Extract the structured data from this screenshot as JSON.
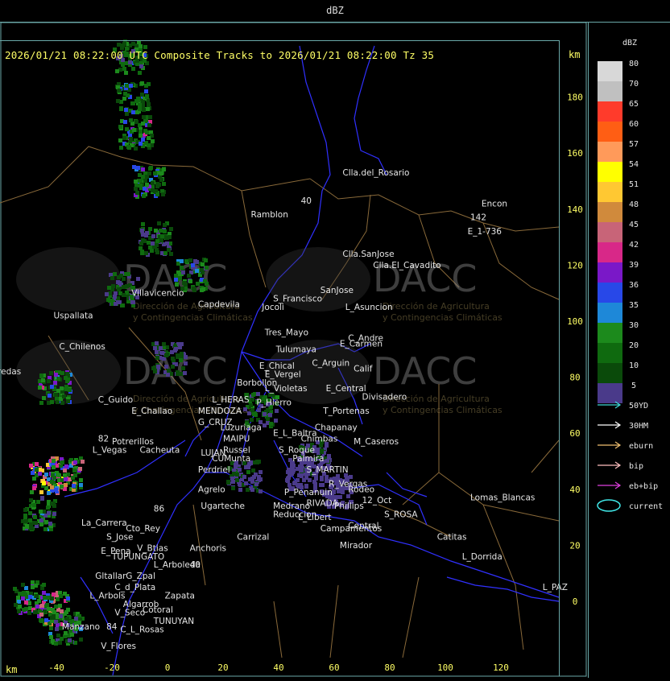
{
  "title_bar": "dBZ",
  "info_line": "2026/01/21 08:22:00 UTC Composite Tracks to 2026/01/21 08:22:00 Tz 35",
  "axis_unit_top": "km",
  "axis_unit_bottom": "km",
  "colors": {
    "frame": "#6aa8a8",
    "tick_text": "#ffff66",
    "province_border": "#8a6a3a",
    "road": "#3030ff",
    "label": "#e6e6e6"
  },
  "chart_data": {
    "type": "heatmap",
    "title": "2026/01/21 08:22:00 UTC Composite Tracks to 2026/01/21 08:22:00 Tz 35",
    "xlabel": "km",
    "ylabel": "km",
    "xlim": [
      -62,
      141
    ],
    "ylim": [
      -22,
      202
    ],
    "x_ticks": [
      -40,
      -20,
      0,
      20,
      40,
      60,
      80,
      100,
      120
    ],
    "y_ticks": [
      0,
      20,
      40,
      60,
      80,
      100,
      120,
      140,
      160,
      180
    ],
    "colorbar": {
      "label": "dBZ",
      "levels": [
        {
          "value": "80",
          "color": "#d8d8d8"
        },
        {
          "value": "70",
          "color": "#c0c0c0"
        },
        {
          "value": "65",
          "color": "#ff3b2b"
        },
        {
          "value": "60",
          "color": "#ff5e14"
        },
        {
          "value": "57",
          "color": "#ff9a5a"
        },
        {
          "value": "54",
          "color": "#ffff00"
        },
        {
          "value": "51",
          "color": "#ffc832"
        },
        {
          "value": "48",
          "color": "#d08a3c"
        },
        {
          "value": "45",
          "color": "#c86478"
        },
        {
          "value": "42",
          "color": "#d82888"
        },
        {
          "value": "39",
          "color": "#7a18c8"
        },
        {
          "value": "36",
          "color": "#2848e8"
        },
        {
          "value": "35",
          "color": "#1e88d8"
        },
        {
          "value": "30",
          "color": "#1c8a1c"
        },
        {
          "value": "20",
          "color": "#0f6a0f"
        },
        {
          "value": "10",
          "color": "#0a4a0a"
        },
        {
          "value": "5",
          "color": "#4a3a8a"
        }
      ]
    },
    "legend": [
      {
        "label": "50YD",
        "color": "#40d8d8"
      },
      {
        "label": "30HM",
        "color": "#ffffff"
      },
      {
        "label": "eburn",
        "color": "#f0c070"
      },
      {
        "label": "bip",
        "color": "#ffc0c0"
      },
      {
        "label": "eb+bip",
        "color": "#e040e0"
      },
      {
        "label": "current",
        "color": "#40e8e8"
      }
    ],
    "locations": [
      {
        "name": "Clla.del_Rosario",
        "x": 63,
        "y": 152
      },
      {
        "name": "Encon",
        "x": 113,
        "y": 141
      },
      {
        "name": "E_1-736",
        "x": 108,
        "y": 131
      },
      {
        "name": "Ramblon",
        "x": 30,
        "y": 137
      },
      {
        "name": "Clla.SanJose",
        "x": 63,
        "y": 123
      },
      {
        "name": "Clla.El_Cavadito",
        "x": 74,
        "y": 119
      },
      {
        "name": "Villavicencio",
        "x": -13,
        "y": 109
      },
      {
        "name": "Capdevila",
        "x": 11,
        "y": 105
      },
      {
        "name": "S_Francisco",
        "x": 38,
        "y": 107
      },
      {
        "name": "SanJose",
        "x": 55,
        "y": 110
      },
      {
        "name": "Jocoli",
        "x": 34,
        "y": 104
      },
      {
        "name": "L_Asuncion",
        "x": 64,
        "y": 104
      },
      {
        "name": "Uspallata",
        "x": -41,
        "y": 101
      },
      {
        "name": "Tres_Mayo",
        "x": 35,
        "y": 95
      },
      {
        "name": "C_Andre",
        "x": 65,
        "y": 93
      },
      {
        "name": "C_Chilenos",
        "x": -39,
        "y": 90
      },
      {
        "name": "Tulumaya",
        "x": 39,
        "y": 89
      },
      {
        "name": "E_Carmen",
        "x": 62,
        "y": 91
      },
      {
        "name": "C_Arguin",
        "x": 52,
        "y": 84
      },
      {
        "name": "Calif",
        "x": 67,
        "y": 82
      },
      {
        "name": "E_Chical",
        "x": 33,
        "y": 83
      },
      {
        "name": "E_Vergel",
        "x": 35,
        "y": 80
      },
      {
        "name": "Borbollon",
        "x": 25,
        "y": 77
      },
      {
        "name": "L_Violetas",
        "x": 35,
        "y": 75
      },
      {
        "name": "E_Central",
        "x": 57,
        "y": 75
      },
      {
        "name": "Divisadero",
        "x": 70,
        "y": 72
      },
      {
        "name": "L_HERAS",
        "x": 16,
        "y": 71
      },
      {
        "name": "C_Guido",
        "x": -25,
        "y": 71
      },
      {
        "name": "P_Hierro",
        "x": 32,
        "y": 70
      },
      {
        "name": "E_Challao",
        "x": -13,
        "y": 67
      },
      {
        "name": "MENDOZA",
        "x": 11,
        "y": 67
      },
      {
        "name": "T_Portenas",
        "x": 56,
        "y": 67
      },
      {
        "name": "G_CRUZ",
        "x": 11,
        "y": 63
      },
      {
        "name": "Luzuriaga",
        "x": 19,
        "y": 61
      },
      {
        "name": "Chapanay",
        "x": 53,
        "y": 61
      },
      {
        "name": "E_L_Baltra",
        "x": 38,
        "y": 59
      },
      {
        "name": "Chimbas",
        "x": 48,
        "y": 57
      },
      {
        "name": "M_Caseros",
        "x": 67,
        "y": 56
      },
      {
        "name": "MAIPU",
        "x": 20,
        "y": 57
      },
      {
        "name": "Potrerillos",
        "x": -20,
        "y": 56
      },
      {
        "name": "Russel",
        "x": 20,
        "y": 53
      },
      {
        "name": "S_Roque",
        "x": 40,
        "y": 53
      },
      {
        "name": "L_Vegas",
        "x": -27,
        "y": 53
      },
      {
        "name": "Cacheuta",
        "x": -10,
        "y": 53
      },
      {
        "name": "LUJAN",
        "x": 12,
        "y": 52
      },
      {
        "name": "Palmira",
        "x": 45,
        "y": 50
      },
      {
        "name": "CUMunta",
        "x": 16,
        "y": 50
      },
      {
        "name": "Perdriel",
        "x": 11,
        "y": 46
      },
      {
        "name": "S_MARTIN",
        "x": 50,
        "y": 46
      },
      {
        "name": "Agrelo",
        "x": 11,
        "y": 39
      },
      {
        "name": "R_Vergas",
        "x": 58,
        "y": 41
      },
      {
        "name": "Rodeo",
        "x": 65,
        "y": 39
      },
      {
        "name": "P_Penanuin",
        "x": 42,
        "y": 38
      },
      {
        "name": "Lomas_Blancas",
        "x": 109,
        "y": 36
      },
      {
        "name": "RIVADA",
        "x": 50,
        "y": 34
      },
      {
        "name": "Phillips",
        "x": 60,
        "y": 33
      },
      {
        "name": "12_Oct",
        "x": 70,
        "y": 35
      },
      {
        "name": "Medrano",
        "x": 38,
        "y": 33
      },
      {
        "name": "Ugarteche",
        "x": 12,
        "y": 33
      },
      {
        "name": "Reduccion",
        "x": 38,
        "y": 30
      },
      {
        "name": "S_ROSA",
        "x": 78,
        "y": 30
      },
      {
        "name": "L_Libert",
        "x": 47,
        "y": 29
      },
      {
        "name": "La_Carrera",
        "x": -31,
        "y": 27
      },
      {
        "name": "Cto_Rey",
        "x": -15,
        "y": 25
      },
      {
        "name": "Central",
        "x": 65,
        "y": 26
      },
      {
        "name": "Campamentos",
        "x": 55,
        "y": 25
      },
      {
        "name": "S_Jose",
        "x": -22,
        "y": 22
      },
      {
        "name": "Carrizal",
        "x": 25,
        "y": 22
      },
      {
        "name": "Catitas",
        "x": 97,
        "y": 22
      },
      {
        "name": "Mirador",
        "x": 62,
        "y": 19
      },
      {
        "name": "Anchoris",
        "x": 8,
        "y": 18
      },
      {
        "name": "E_Pena",
        "x": -24,
        "y": 17
      },
      {
        "name": "V_Btias",
        "x": -11,
        "y": 18
      },
      {
        "name": "TUPUNGATO",
        "x": -20,
        "y": 15
      },
      {
        "name": "L_Dorrida",
        "x": 106,
        "y": 15
      },
      {
        "name": "L_Arboleda",
        "x": -5,
        "y": 12
      },
      {
        "name": "G_Zpal",
        "x": -15,
        "y": 8
      },
      {
        "name": "Gltallar",
        "x": -26,
        "y": 8
      },
      {
        "name": "C_d_Plata",
        "x": -19,
        "y": 4
      },
      {
        "name": "L_Arbols",
        "x": -28,
        "y": 1
      },
      {
        "name": "Zapata",
        "x": -1,
        "y": 1
      },
      {
        "name": "L_PAZ",
        "x": 135,
        "y": 4
      },
      {
        "name": "Algarrob",
        "x": -16,
        "y": -2
      },
      {
        "name": "Cotoral",
        "x": -9,
        "y": -4
      },
      {
        "name": "V_Seco",
        "x": -19,
        "y": -5
      },
      {
        "name": "TUNUYAN",
        "x": -5,
        "y": -8
      },
      {
        "name": "Manzano",
        "x": -38,
        "y": -10
      },
      {
        "name": "C_L_Rosas",
        "x": -17,
        "y": -11
      },
      {
        "name": "V_Flores",
        "x": -24,
        "y": -17
      },
      {
        "name": "aredas",
        "x": -63,
        "y": 81
      },
      {
        "name": "142",
        "x": 109,
        "y": 136
      },
      {
        "name": "40",
        "x": 48,
        "y": 142
      },
      {
        "name": "82",
        "x": -25,
        "y": 57
      },
      {
        "name": "84",
        "x": -22,
        "y": -10
      },
      {
        "name": "86",
        "x": -5,
        "y": 32
      },
      {
        "name": "40",
        "x": 8,
        "y": 12
      }
    ],
    "echo_clusters": [
      {
        "x": -14,
        "y": 195,
        "dbz": 36
      },
      {
        "x": -13,
        "y": 180,
        "dbz": 39
      },
      {
        "x": -12,
        "y": 168,
        "dbz": 42
      },
      {
        "x": -7,
        "y": 150,
        "dbz": 39
      },
      {
        "x": -5,
        "y": 130,
        "dbz": 30
      },
      {
        "x": 8,
        "y": 117,
        "dbz": 36
      },
      {
        "x": -17,
        "y": 112,
        "dbz": 30
      },
      {
        "x": 0,
        "y": 87,
        "dbz": 20
      },
      {
        "x": -41,
        "y": 77,
        "dbz": 42
      },
      {
        "x": -44,
        "y": 45,
        "dbz": 54
      },
      {
        "x": -37,
        "y": 46,
        "dbz": 51
      },
      {
        "x": -47,
        "y": 32,
        "dbz": 35
      },
      {
        "x": -50,
        "y": 2,
        "dbz": 42
      },
      {
        "x": -42,
        "y": -2,
        "dbz": 48
      },
      {
        "x": -37,
        "y": -9,
        "dbz": 35
      },
      {
        "x": 48,
        "y": 46,
        "dbz": 5
      },
      {
        "x": 52,
        "y": 52,
        "dbz": 20
      },
      {
        "x": 60,
        "y": 40,
        "dbz": 5
      },
      {
        "x": 33,
        "y": 69,
        "dbz": 30
      },
      {
        "x": 27,
        "y": 45,
        "dbz": 20
      }
    ]
  },
  "watermark": {
    "brand": "DACC",
    "subtitle_1": "Dirección de Agricultura",
    "subtitle_2": "y Contingencias Climáticas"
  }
}
